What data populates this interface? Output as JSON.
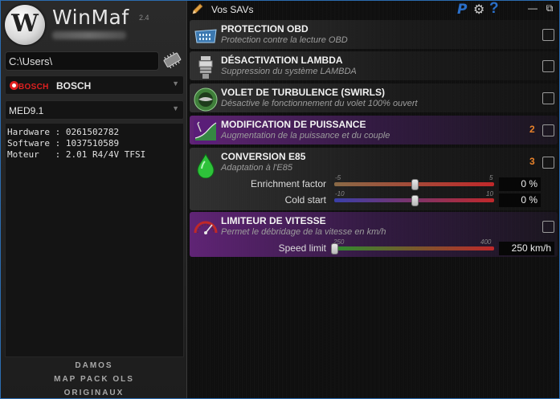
{
  "app": {
    "name": "WinMaf",
    "version": "2.4"
  },
  "left": {
    "path": "C:\\Users\\",
    "brand_logo": "BOSCH",
    "brand": "BOSCH",
    "ecu": "MED9.1",
    "info": {
      "hardware_label": "Hardware :",
      "hardware": "0261502782",
      "software_label": "Software :",
      "software": "1037510589",
      "moteur_label": "Moteur   :",
      "moteur": "2.01 R4/4V TFSI"
    },
    "links": [
      "DAMOS",
      "MAP PACK OLS",
      "ORIGINAUX"
    ]
  },
  "topbar": {
    "title": "Vos SAVs",
    "paypal_glyph": "P",
    "help_glyph": "?",
    "minimize": "—",
    "restore": "⧉",
    "close": "✕",
    "icons": [
      "pencil-icon",
      "paypal-icon",
      "gear-icon",
      "help-icon"
    ]
  },
  "features": [
    {
      "title": "PROTECTION OBD",
      "desc": "Protection contre la lecture OBD",
      "badge": "",
      "checked": false,
      "icon": "obd-connector-icon"
    },
    {
      "title": "DÉSACTIVATION LAMBDA",
      "desc": "Suppression du système LAMBDA",
      "badge": "",
      "checked": false,
      "icon": "lambda-sensor-icon"
    },
    {
      "title": "VOLET DE TURBULENCE (SWIRLS)",
      "desc": "Désactive le fonctionnement du volet 100% ouvert",
      "badge": "",
      "checked": false,
      "icon": "swirl-flap-icon"
    },
    {
      "title": "MODIFICATION DE PUISSANCE",
      "desc": "Augmentation de la puissance et du couple",
      "badge": "2",
      "checked": false,
      "icon": "power-curve-icon"
    },
    {
      "title": "CONVERSION E85",
      "desc": "Adaptation à l'E85",
      "badge": "3",
      "checked": false,
      "icon": "fuel-drop-icon",
      "sliders": [
        {
          "label": "Enrichment factor",
          "min": "-5",
          "max": "5",
          "value": 0,
          "display": "0 %",
          "color": "#8a6a46"
        },
        {
          "label": "Cold start",
          "min": "-10",
          "max": "10",
          "value": 0,
          "display": "0 %",
          "color": "#3a3fa8"
        }
      ]
    },
    {
      "title": "LIMITEUR DE VITESSE",
      "desc": "Permet le débridage de la vitesse en km/h",
      "badge": "",
      "checked": false,
      "icon": "speedometer-icon",
      "sliders": [
        {
          "label": "Speed limit",
          "min": "250",
          "max": "400",
          "value": 250,
          "display": "250 km/h",
          "color": "#2f8a2f"
        }
      ]
    }
  ],
  "colors": {
    "accent_blue": "#2a6fc9",
    "badge_orange": "#e8822a",
    "power_purple": "#682680"
  }
}
